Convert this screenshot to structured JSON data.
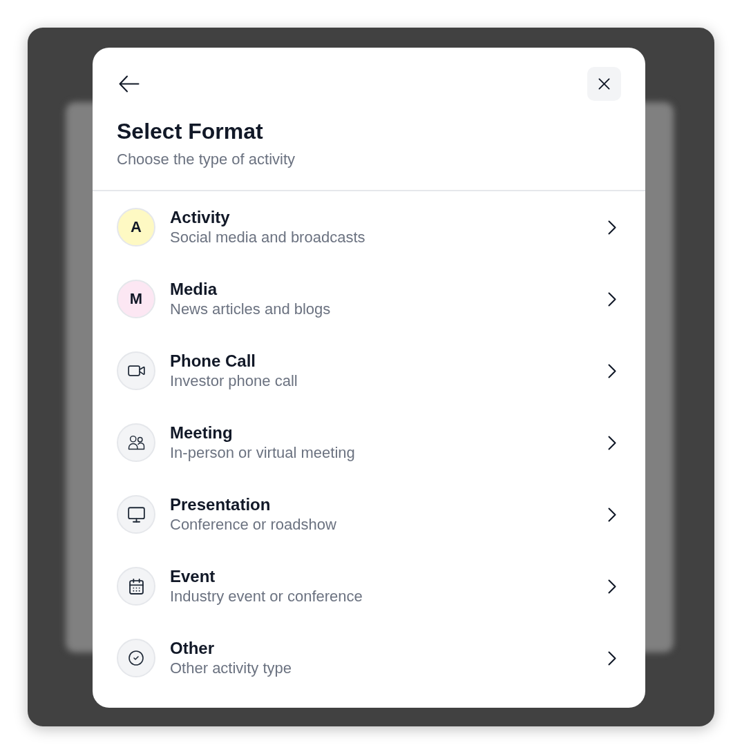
{
  "dialog": {
    "title": "Select Format",
    "subtitle": "Choose the type of activity"
  },
  "options": [
    {
      "kind": "letter",
      "badge": "A",
      "color": "#fef9c3",
      "title": "Activity",
      "description": "Social media and broadcasts"
    },
    {
      "kind": "letter",
      "badge": "M",
      "color": "#fce7f3",
      "title": "Media",
      "description": "News articles and blogs"
    },
    {
      "kind": "icon",
      "title": "Phone Call",
      "description": "Investor phone call"
    },
    {
      "kind": "icon",
      "title": "Meeting",
      "description": "In-person or virtual meeting"
    },
    {
      "kind": "icon",
      "title": "Presentation",
      "description": "Conference or roadshow"
    },
    {
      "kind": "icon",
      "title": "Event",
      "description": "Industry event or conference"
    },
    {
      "kind": "icon",
      "title": "Other",
      "description": "Other activity type"
    }
  ]
}
